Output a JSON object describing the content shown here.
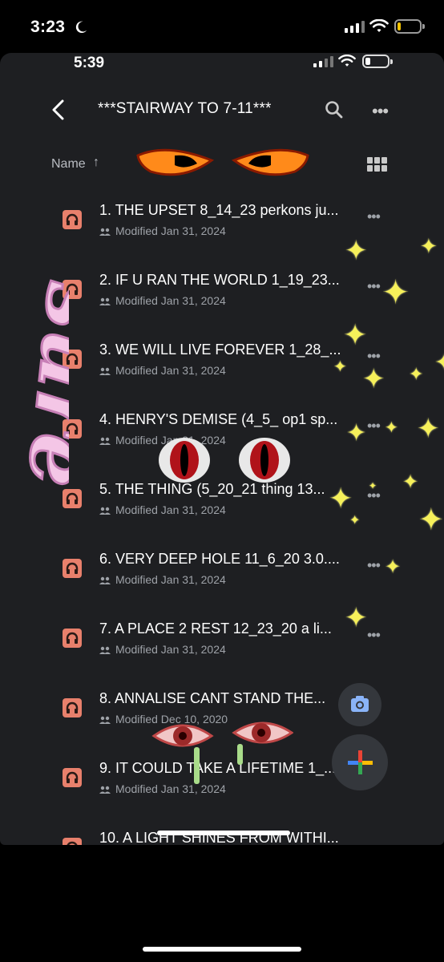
{
  "outer_status": {
    "time": "3:23"
  },
  "inner_status": {
    "time": "5:39"
  },
  "header": {
    "title": "***STAIRWAY TO 7-11***",
    "more_label": "•••"
  },
  "sort": {
    "label": "Name",
    "arrow": "↑"
  },
  "files": [
    {
      "name": "1. THE UPSET 8_14_23 perkons ju...",
      "modified": "Modified Jan 31, 2024",
      "more": "•••"
    },
    {
      "name": "2. IF U RAN THE WORLD 1_19_23...",
      "modified": "Modified Jan 31, 2024",
      "more": "•••"
    },
    {
      "name": "3. WE WILL LIVE FOREVER 1_28_...",
      "modified": "Modified Jan 31, 2024",
      "more": "•••"
    },
    {
      "name": "4. HENRY'S DEMISE (4_5_ op1 sp...",
      "modified": "Modified Jan 31, 2024",
      "more": "•••"
    },
    {
      "name": "5. THE THING (5_20_21 thing 13...",
      "modified": "Modified Jan 31, 2024",
      "more": "•••"
    },
    {
      "name": "6. VERY DEEP HOLE 11_6_20 3.0....",
      "modified": "Modified Jan 31, 2024",
      "more": "•••"
    },
    {
      "name": "7. A PLACE 2 REST 12_23_20 a li...",
      "modified": "Modified Jan 31, 2024",
      "more": "•••"
    },
    {
      "name": "8. ANNALISE CANT STAND THE...",
      "modified": "Modified Dec 10, 2020",
      "more": "•••"
    },
    {
      "name": "9. IT COULD TAKE A LIFETIME 1_...",
      "modified": "Modified Jan 31, 2024",
      "more": "•••"
    },
    {
      "name": "10. A LIGHT SHINES FROM WITHI...",
      "modified": "",
      "more": ""
    }
  ],
  "colors": {
    "background": "#1e1f22",
    "file_icon": "#e8806c",
    "meta_text": "#9ea2a8",
    "sparkle": "#f6f05a",
    "overlay_text": "#f4c6e6"
  },
  "icons": {
    "back": "chevron-left-icon",
    "search": "search-icon",
    "more": "more-horizontal-icon",
    "grid": "grid-view-icon",
    "file": "audio-file-icon",
    "shared": "shared-people-icon",
    "camera": "camera-icon",
    "new": "plus-icon"
  },
  "sticker_text": "sure"
}
